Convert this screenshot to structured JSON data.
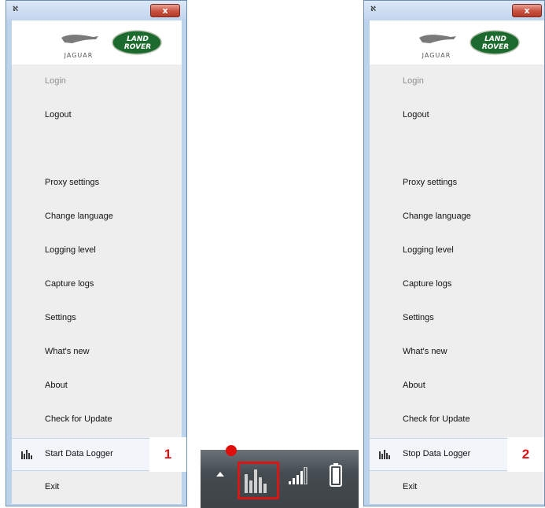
{
  "left_window": {
    "close_label": "x",
    "menu_items": [
      {
        "label": "Login",
        "disabled": true
      },
      {
        "label": "Logout"
      },
      {
        "label": ""
      },
      {
        "label": "Proxy settings"
      },
      {
        "label": "Change language"
      },
      {
        "label": "Logging level"
      },
      {
        "label": "Capture logs"
      },
      {
        "label": "Settings"
      },
      {
        "label": "What's new"
      },
      {
        "label": "About"
      },
      {
        "label": "Check for Update"
      },
      {
        "label": "Start Data Logger",
        "highlighted": true,
        "icon": "bar-chart-icon"
      },
      {
        "label": "Exit"
      }
    ],
    "step_badge": "1"
  },
  "right_window": {
    "close_label": "x",
    "menu_items": [
      {
        "label": "Login",
        "disabled": true
      },
      {
        "label": "Logout"
      },
      {
        "label": ""
      },
      {
        "label": "Proxy settings"
      },
      {
        "label": "Change language"
      },
      {
        "label": "Logging level"
      },
      {
        "label": "Capture logs"
      },
      {
        "label": "Settings"
      },
      {
        "label": "What's new"
      },
      {
        "label": "About"
      },
      {
        "label": "Check for Update"
      },
      {
        "label": "Stop Data Logger",
        "highlighted": true,
        "icon": "bar-chart-icon"
      },
      {
        "label": "Exit"
      }
    ],
    "step_badge": "2"
  },
  "logos": {
    "jaguar": "JAGUAR",
    "land_rover_line1": "LAND",
    "land_rover_line2": "ROVER"
  },
  "taskbar": {
    "icons": [
      "show-hidden-icons-arrow",
      "data-logger-tray-icon",
      "signal-strength-icon",
      "battery-icon"
    ]
  },
  "colors": {
    "highlight_box": "#d91616",
    "badge_text": "#dd1111",
    "land_rover_green": "#1d6a2f"
  }
}
